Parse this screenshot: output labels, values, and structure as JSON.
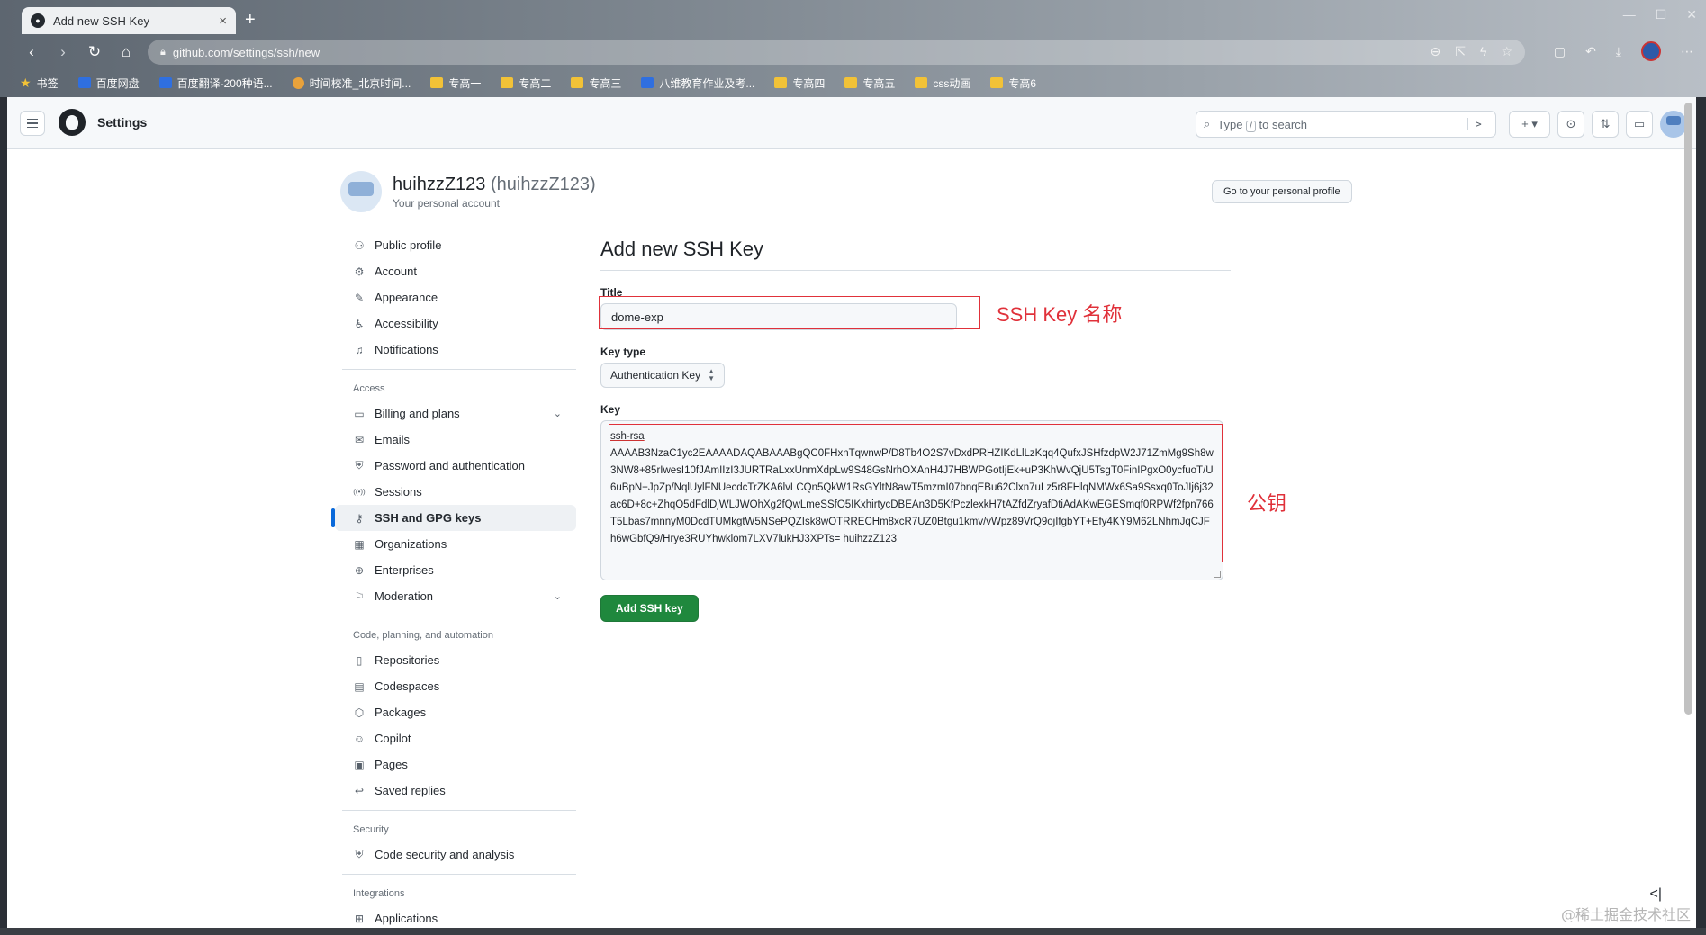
{
  "browser": {
    "tab_title": "Add new SSH Key",
    "new_tab_symbol": "+",
    "close_symbol": "×",
    "url": "github.com/settings/ssh/new",
    "bookmarks": [
      {
        "label": "书签",
        "icon": "star"
      },
      {
        "label": "百度网盘",
        "icon": "blue"
      },
      {
        "label": "百度翻译-200种语...",
        "icon": "blue"
      },
      {
        "label": "时间校准_北京时间...",
        "icon": "round"
      },
      {
        "label": "专高一",
        "icon": "folder"
      },
      {
        "label": "专高二",
        "icon": "folder"
      },
      {
        "label": "专高三",
        "icon": "folder"
      },
      {
        "label": "八维教育作业及考...",
        "icon": "blue"
      },
      {
        "label": "专高四",
        "icon": "folder"
      },
      {
        "label": "专高五",
        "icon": "folder"
      },
      {
        "label": "css动画",
        "icon": "folder"
      },
      {
        "label": "专高6",
        "icon": "folder"
      }
    ]
  },
  "header": {
    "title": "Settings",
    "search_prefix": "Type",
    "search_key": "/",
    "search_suffix": "to search",
    "command_symbol": ">_",
    "plus_label": "+ ▾"
  },
  "user": {
    "name": "huihzzZ123",
    "handle": "(huihzzZ123)",
    "subtitle": "Your personal account",
    "profile_button": "Go to your personal profile"
  },
  "sidebar": {
    "group1": [
      {
        "label": "Public profile",
        "icon": "person-icon",
        "glyph": "⚇"
      },
      {
        "label": "Account",
        "icon": "gear-icon",
        "glyph": "⚙"
      },
      {
        "label": "Appearance",
        "icon": "paintbrush-icon",
        "glyph": "✎"
      },
      {
        "label": "Accessibility",
        "icon": "accessibility-icon",
        "glyph": "♿"
      },
      {
        "label": "Notifications",
        "icon": "bell-icon",
        "glyph": "♫"
      }
    ],
    "access_heading": "Access",
    "group2": [
      {
        "label": "Billing and plans",
        "icon": "credit-card-icon",
        "glyph": "▭",
        "expandable": true
      },
      {
        "label": "Emails",
        "icon": "mail-icon",
        "glyph": "✉"
      },
      {
        "label": "Password and authentication",
        "icon": "shield-icon",
        "glyph": "⛨"
      },
      {
        "label": "Sessions",
        "icon": "broadcast-icon",
        "glyph": "((•))"
      },
      {
        "label": "SSH and GPG keys",
        "icon": "key-icon",
        "glyph": "⚷",
        "active": true
      },
      {
        "label": "Organizations",
        "icon": "organization-icon",
        "glyph": "▦"
      },
      {
        "label": "Enterprises",
        "icon": "globe-icon",
        "glyph": "⊕"
      },
      {
        "label": "Moderation",
        "icon": "report-icon",
        "glyph": "⚐",
        "expandable": true
      }
    ],
    "code_heading": "Code, planning, and automation",
    "group3": [
      {
        "label": "Repositories",
        "icon": "repo-icon",
        "glyph": "▯"
      },
      {
        "label": "Codespaces",
        "icon": "codespaces-icon",
        "glyph": "▤"
      },
      {
        "label": "Packages",
        "icon": "package-icon",
        "glyph": "⬡"
      },
      {
        "label": "Copilot",
        "icon": "copilot-icon",
        "glyph": "☺"
      },
      {
        "label": "Pages",
        "icon": "browser-icon",
        "glyph": "▣"
      },
      {
        "label": "Saved replies",
        "icon": "reply-icon",
        "glyph": "↩"
      }
    ],
    "security_heading": "Security",
    "group4": [
      {
        "label": "Code security and analysis",
        "icon": "shield-lock-icon",
        "glyph": "⛨"
      }
    ],
    "integrations_heading": "Integrations",
    "group5": [
      {
        "label": "Applications",
        "icon": "apps-icon",
        "glyph": "⊞"
      }
    ]
  },
  "main": {
    "title": "Add new SSH Key",
    "title_label": "Title",
    "title_value": "dome-exp",
    "key_type_label": "Key type",
    "key_type_value": "Authentication Key",
    "key_label": "Key",
    "key_line1": "ssh-rsa",
    "key_rest": "AAAAB3NzaC1yc2EAAAADAQABAAABgQC0FHxnTqwnwP/D8Tb4O2S7vDxdPRHZIKdLlLzKqq4QufxJSHfzdpW2J71ZmMg9Sh8w3NW8+85rIwesI10fJAmIIzI3JURTRaLxxUnmXdpLw9S48GsNrhOXAnH4J7HBWPGotIjEk+uP3KhWvQjU5TsgT0FinIPgxO0ycfuoT/U6uBpN+JpZp/NqlUylFNUecdcTrZKA6lvLCQn5QkW1RsGYltN8awT5mzmI07bnqEBu62Clxn7uLz5r8FHlqNMWx6Sa9Ssxq0ToJIj6j32ac6D+8c+ZhqO5dFdlDjWLJWOhXg2fQwLmeSSfO5IKxhirtycDBEAn3D5KfPczlexkH7tAZfdZryafDtiAdAKwEGESmqf0RPWf2fpn766T5Lbas7mnnyM0DcdTUMkgtW5NSePQZIsk8wOTRRECHm8xcR7UZ0Btgu1kmv/vWpz89VrQ9ojIfgbYT+Efy4KY9M62LNhmJqCJFh6wGbfQ9/Hrye3RUYhwklom7LXV7lukHJ3XPTs= huihzzZ123",
    "submit_label": "Add SSH key"
  },
  "annotations": {
    "title_note": "SSH Key 名称",
    "key_note": "公钥",
    "color": "#e0313a"
  },
  "watermark": "@稀土掘金技术社区",
  "corner_icon_glyph": "<|"
}
